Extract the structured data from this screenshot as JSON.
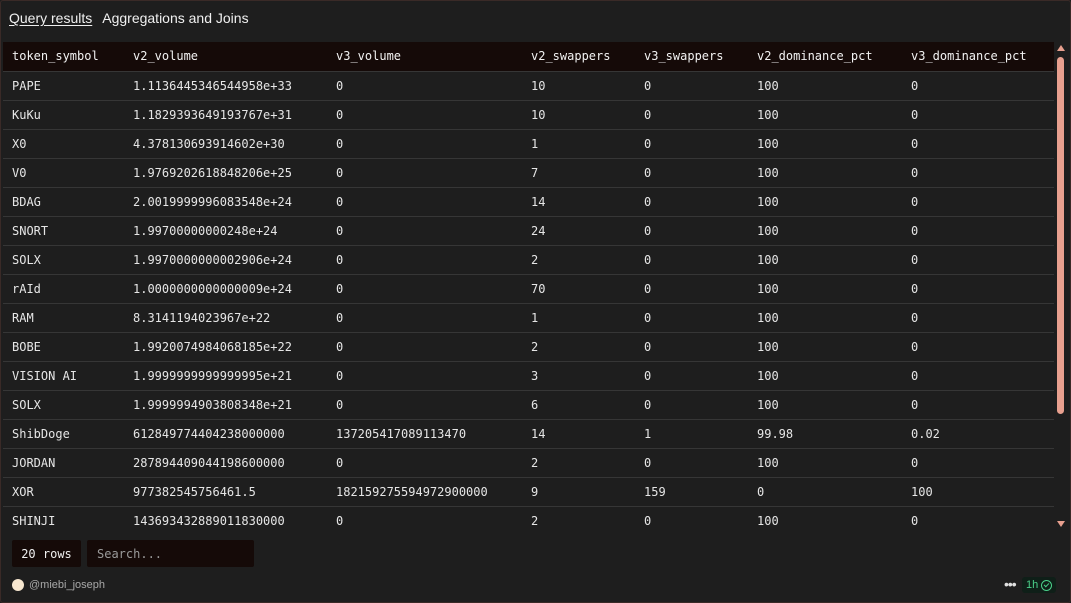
{
  "tabs": [
    {
      "label": "Query results"
    },
    {
      "label": "Aggregations and Joins"
    }
  ],
  "table": {
    "columns": [
      "token_symbol",
      "v2_volume",
      "v3_volume",
      "v2_swappers",
      "v3_swappers",
      "v2_dominance_pct",
      "v3_dominance_pct"
    ],
    "rows": [
      [
        "PAPE",
        "1.1136445346544958e+33",
        "0",
        "10",
        "0",
        "100",
        "0"
      ],
      [
        "KuKu",
        "1.1829393649193767e+31",
        "0",
        "10",
        "0",
        "100",
        "0"
      ],
      [
        "X0",
        "4.378130693914602e+30",
        "0",
        "1",
        "0",
        "100",
        "0"
      ],
      [
        "V0",
        "1.9769202618848206e+25",
        "0",
        "7",
        "0",
        "100",
        "0"
      ],
      [
        "BDAG",
        "2.0019999996083548e+24",
        "0",
        "14",
        "0",
        "100",
        "0"
      ],
      [
        "SNORT",
        "1.99700000000248e+24",
        "0",
        "24",
        "0",
        "100",
        "0"
      ],
      [
        "SOLX",
        "1.9970000000002906e+24",
        "0",
        "2",
        "0",
        "100",
        "0"
      ],
      [
        "rAId",
        "1.0000000000000009e+24",
        "0",
        "70",
        "0",
        "100",
        "0"
      ],
      [
        "RAM",
        "8.3141194023967e+22",
        "0",
        "1",
        "0",
        "100",
        "0"
      ],
      [
        "BOBE",
        "1.9920074984068185e+22",
        "0",
        "2",
        "0",
        "100",
        "0"
      ],
      [
        "VISION AI",
        "1.9999999999999995e+21",
        "0",
        "3",
        "0",
        "100",
        "0"
      ],
      [
        "SOLX",
        "1.9999994903808348e+21",
        "0",
        "6",
        "0",
        "100",
        "0"
      ],
      [
        "ShibDoge",
        "612849774404238000000",
        "137205417089113470",
        "14",
        "1",
        "99.98",
        "0.02"
      ],
      [
        "JORDAN",
        "287894409044198600000",
        "0",
        "2",
        "0",
        "100",
        "0"
      ],
      [
        "XOR",
        "977382545756461.5",
        "182159275594972900000",
        "9",
        "159",
        "0",
        "100"
      ],
      [
        "SHINJI",
        "143693432889011830000",
        "0",
        "2",
        "0",
        "100",
        "0"
      ]
    ]
  },
  "footer": {
    "row_count": "20 rows",
    "search_placeholder": "Search...",
    "author": "@miebi_joseph",
    "more_label": "•••",
    "age": "1h"
  },
  "icons": {
    "avatar": "avatar",
    "status": "check-circle-icon"
  },
  "colors": {
    "accent": "#e8a08f",
    "status_green": "#4bd08a",
    "header_bg": "#150a08",
    "background": "#1e1e1e"
  }
}
